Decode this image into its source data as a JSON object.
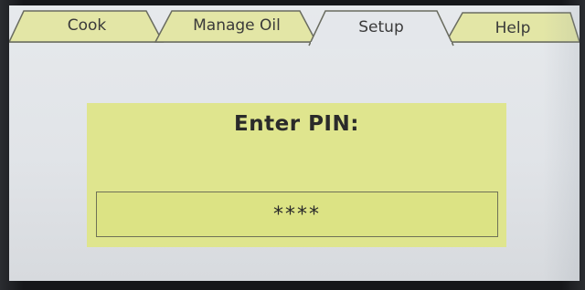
{
  "tabs": [
    {
      "label": "Cook",
      "active": false
    },
    {
      "label": "Manage Oil",
      "active": false
    },
    {
      "label": "Setup",
      "active": true
    },
    {
      "label": "Help",
      "active": false
    }
  ],
  "pin_dialog": {
    "title": "Enter PIN:",
    "masked_value": "****"
  },
  "colors": {
    "inactive_tab": "#e3e6a6",
    "active_tab": "#e4e7eb",
    "panel": "#dfe58e",
    "screen_background": "#e2e5e9"
  }
}
